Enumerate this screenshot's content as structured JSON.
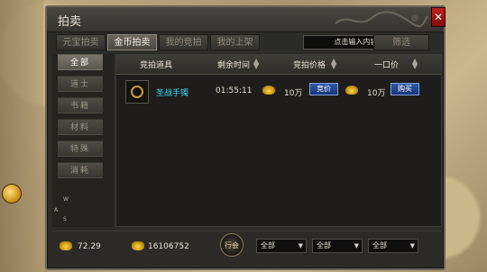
{
  "window": {
    "title": "拍卖"
  },
  "tabs": [
    {
      "label": "元宝拍卖",
      "active": false
    },
    {
      "label": "金币拍卖",
      "active": true
    },
    {
      "label": "我的竞拍",
      "active": false
    },
    {
      "label": "我的上架",
      "active": false
    }
  ],
  "search": {
    "placeholder": "点击输入内容!"
  },
  "filter_label": "筛选",
  "categories": [
    "全部",
    "道士",
    "书籍",
    "材料",
    "特殊",
    "消耗"
  ],
  "table": {
    "headers": [
      "竞拍道具",
      "剩余时间",
      "竞拍价格",
      "一口价"
    ],
    "rows": [
      {
        "name": "圣战手镯",
        "time_left": "01:55:11",
        "bid_price": "10万",
        "bid_button": "竞价",
        "buyout_price": "10万",
        "buy_button": "购买"
      }
    ]
  },
  "footer": {
    "balance_1": "72.29",
    "balance_2": "16106752",
    "emblem_text": "行会",
    "filters": [
      "全部",
      "全部",
      "全部"
    ]
  },
  "compass_letters": [
    "W",
    "A",
    "S"
  ],
  "colors": {
    "accent_blue": "#2f5aa6",
    "item_cyan": "#3fd4f0",
    "close_red": "#c0241f"
  }
}
